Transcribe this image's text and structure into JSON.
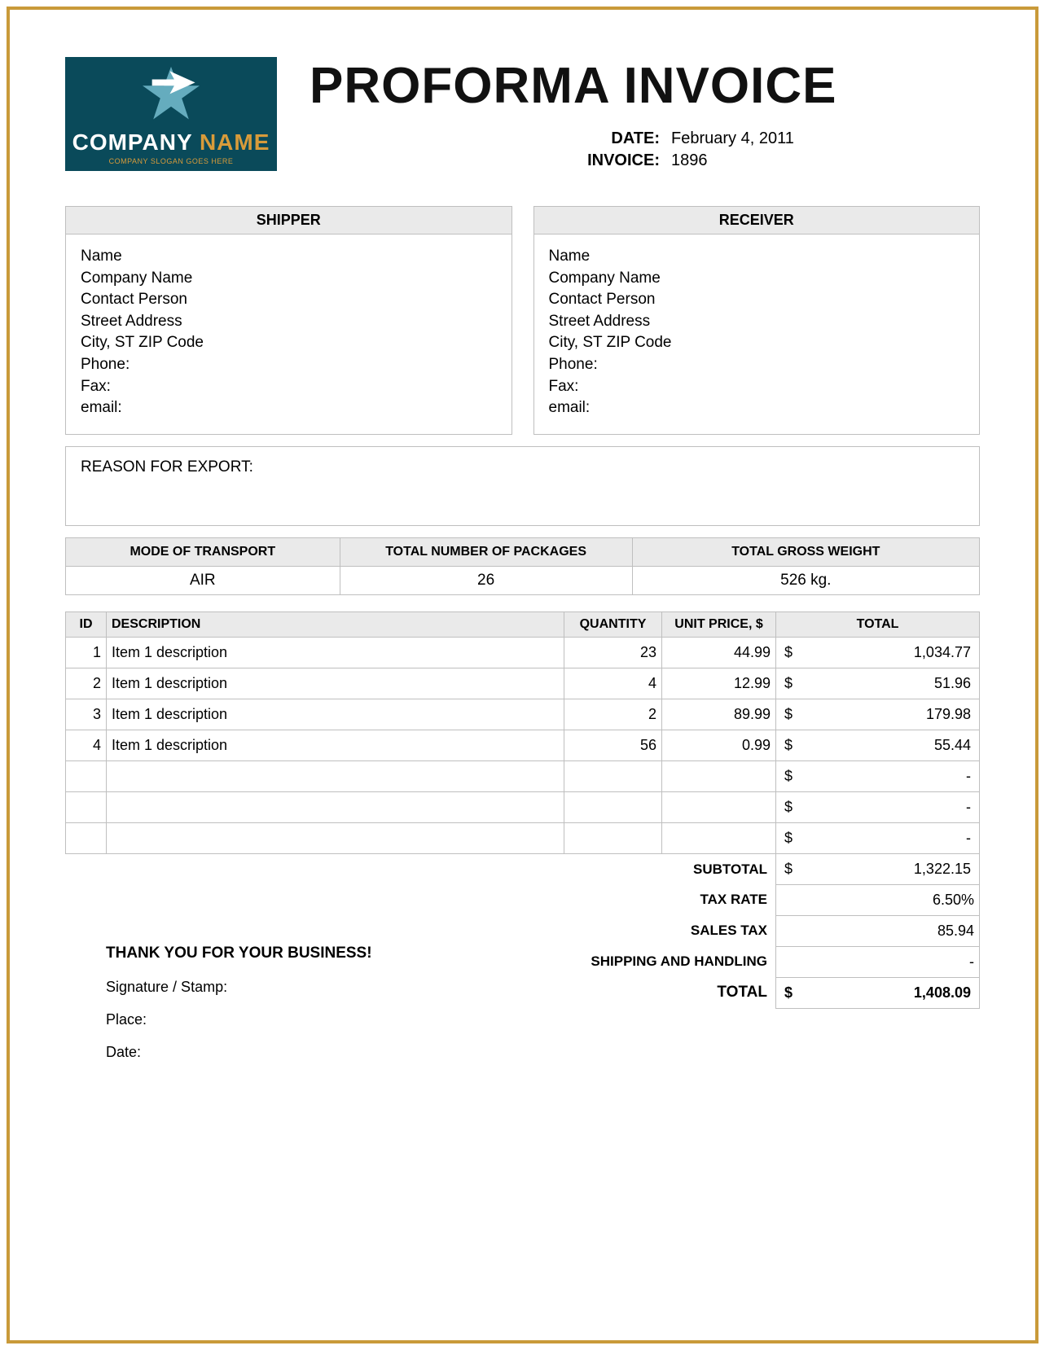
{
  "logo": {
    "company_text_1": "COMPANY",
    "company_text_2": "NAME",
    "slogan": "COMPANY SLOGAN GOES HERE"
  },
  "title": "PROFORMA INVOICE",
  "meta": {
    "date_label": "DATE:",
    "date_value": "February 4, 2011",
    "invoice_label": "INVOICE:",
    "invoice_value": "1896"
  },
  "shipper": {
    "heading": "SHIPPER",
    "lines": [
      "Name",
      "Company Name",
      "Contact Person",
      "Street Address",
      "City, ST  ZIP Code",
      "Phone:",
      "Fax:",
      "email:"
    ]
  },
  "receiver": {
    "heading": "RECEIVER",
    "lines": [
      "Name",
      "Company Name",
      "Contact Person",
      "Street Address",
      "City, ST  ZIP Code",
      "Phone:",
      "Fax:",
      "email:"
    ]
  },
  "reason_label": "REASON FOR EXPORT:",
  "summary": {
    "headers": [
      "MODE OF TRANSPORT",
      "TOTAL NUMBER OF PACKAGES",
      "TOTAL GROSS WEIGHT"
    ],
    "values": [
      "AIR",
      "26",
      "526 kg."
    ]
  },
  "items": {
    "headers": {
      "id": "ID",
      "description": "DESCRIPTION",
      "quantity": "QUANTITY",
      "unit": "UNIT PRICE, $",
      "total": "TOTAL"
    },
    "rows": [
      {
        "id": "1",
        "desc": "Item 1 description",
        "qty": "23",
        "unit": "44.99",
        "cur": "$",
        "total": "1,034.77"
      },
      {
        "id": "2",
        "desc": "Item 1 description",
        "qty": "4",
        "unit": "12.99",
        "cur": "$",
        "total": "51.96"
      },
      {
        "id": "3",
        "desc": "Item 1 description",
        "qty": "2",
        "unit": "89.99",
        "cur": "$",
        "total": "179.98"
      },
      {
        "id": "4",
        "desc": "Item 1 description",
        "qty": "56",
        "unit": "0.99",
        "cur": "$",
        "total": "55.44"
      },
      {
        "id": "",
        "desc": "",
        "qty": "",
        "unit": "",
        "cur": "$",
        "total": "-"
      },
      {
        "id": "",
        "desc": "",
        "qty": "",
        "unit": "",
        "cur": "$",
        "total": "-"
      },
      {
        "id": "",
        "desc": "",
        "qty": "",
        "unit": "",
        "cur": "$",
        "total": "-"
      }
    ]
  },
  "totals": {
    "subtotal_label": "SUBTOTAL",
    "subtotal_cur": "$",
    "subtotal_value": "1,322.15",
    "taxrate_label": "TAX RATE",
    "taxrate_value": "6.50%",
    "salestax_label": "SALES TAX",
    "salestax_value": "85.94",
    "shipping_label": "SHIPPING AND HANDLING",
    "shipping_value": "-",
    "total_label": "TOTAL",
    "total_cur": "$",
    "total_value": "1,408.09"
  },
  "footer": {
    "thanks": "THANK YOU FOR YOUR BUSINESS!",
    "signature": "Signature / Stamp:",
    "place": "Place:",
    "date": "Date:"
  }
}
